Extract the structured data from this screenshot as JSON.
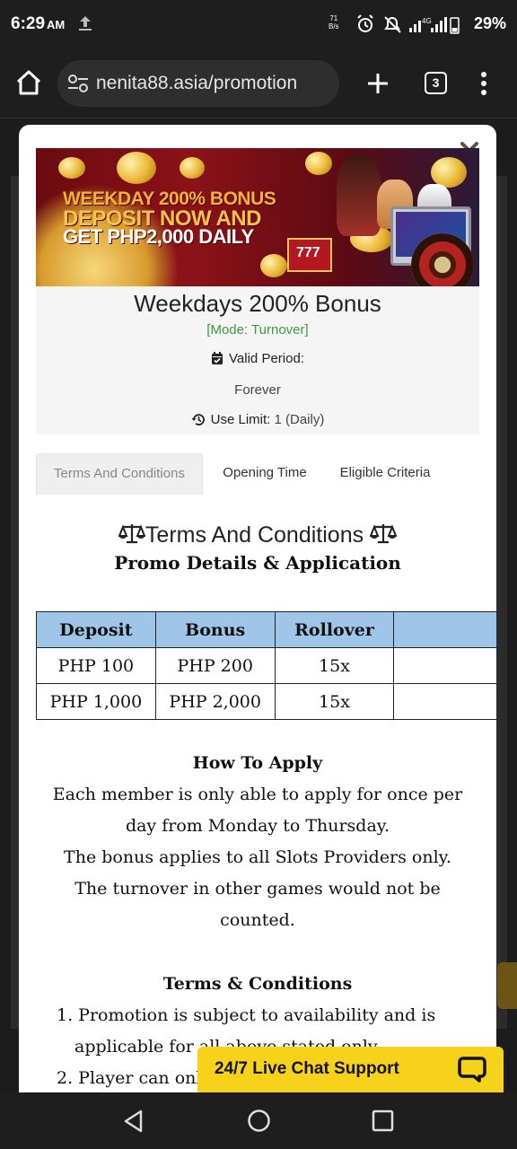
{
  "status_bar": {
    "time": "6:29",
    "ampm": "AM",
    "net_speed_value": "71",
    "net_speed_unit": "B/s",
    "network": "4G",
    "battery": "29%"
  },
  "browser": {
    "url": "nenita88.asia/promotion",
    "tab_count": "3"
  },
  "promo": {
    "banner": {
      "line1": "WEEKDAY 200% BONUS",
      "line2": "DEPOSIT NOW AND",
      "line3": "GET PHP2,000 DAILY",
      "slot_label": "777"
    },
    "title": "Weekdays 200% Bonus",
    "mode": "[Mode: Turnover]",
    "valid_period_label": "Valid Period:",
    "valid_period_value": "Forever",
    "use_limit_label": "Use Limit:",
    "use_limit_value": "1 (Daily)"
  },
  "tabs": [
    {
      "label": "Terms And Conditions",
      "active": true
    },
    {
      "label": "Opening Time",
      "active": false
    },
    {
      "label": "Eligible Criteria",
      "active": false
    }
  ],
  "content": {
    "heading": "Terms And Conditions",
    "subheading": "Promo Details & Application",
    "table": {
      "headers": [
        "Deposit",
        "Bonus",
        "Rollover",
        ""
      ],
      "rows": [
        [
          "PHP 100",
          "PHP 200",
          "15x",
          ""
        ],
        [
          "PHP 1,000",
          "PHP 2,000",
          "15x",
          ""
        ]
      ]
    },
    "how_to_apply_heading": "How To Apply",
    "how_to_apply_lines": [
      "Each member is only able to apply for once per",
      "day from Monday to Thursday.",
      "The bonus applies to all Slots Providers only.",
      "The turnover in other games would not be",
      "counted."
    ],
    "terms_heading": "Terms & Conditions",
    "terms_lines": [
      "1. Promotion is subject to availability and is",
      "applicable for all above stated only.",
      "2. Player can onl"
    ]
  },
  "live_chat": {
    "label": "24/7 Live Chat Support"
  },
  "colors": {
    "table_header": "#9fc5e8",
    "mode_green": "#3e9a3e",
    "live_chat_yellow": "#f6d31a"
  }
}
